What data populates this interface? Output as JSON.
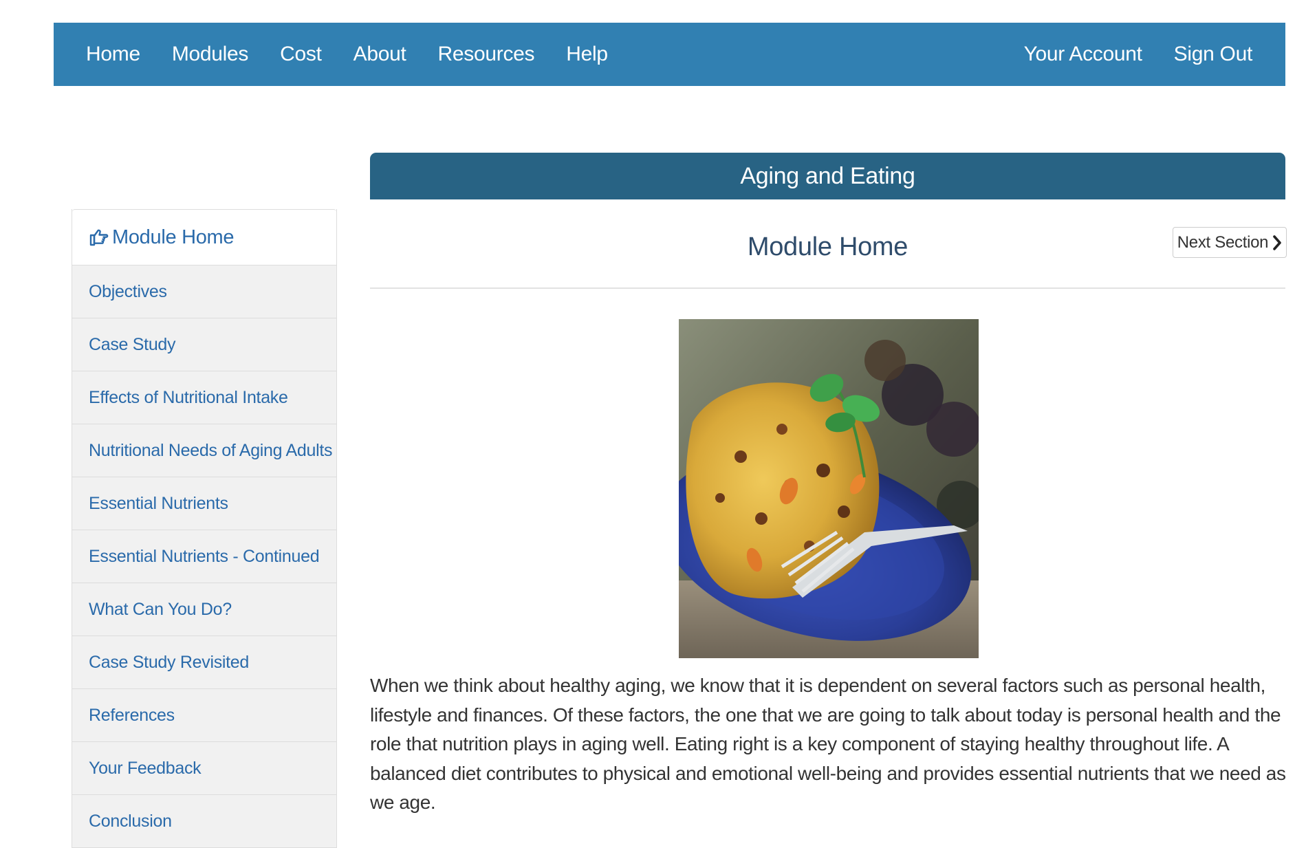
{
  "navbar": {
    "left_items": [
      "Home",
      "Modules",
      "Cost",
      "About",
      "Resources",
      "Help"
    ],
    "right_items": [
      "Your Account",
      "Sign Out"
    ],
    "background_color": "#3180b2"
  },
  "module": {
    "title": "Aging and Eating",
    "header_color": "#286384"
  },
  "sidebar": {
    "active_item": {
      "icon": "hand-pointing-right-icon",
      "label": "Module Home"
    },
    "items": [
      "Objectives",
      "Case Study",
      "Effects of Nutritional Intake",
      "Nutritional Needs of Aging Adults",
      "Essential Nutrients",
      "Essential Nutrients - Continued",
      "What Can You Do?",
      "Case Study Revisited",
      "References",
      "Your Feedback",
      "Conclusion"
    ]
  },
  "content": {
    "section_title": "Module Home",
    "next_button": {
      "label": "Next Section",
      "icon": "chevron-right-icon"
    },
    "image": {
      "subject": "food-photo-couscous-plate"
    },
    "intro_paragraph": "When we think about healthy aging, we know that it is dependent on several factors such as personal health, lifestyle and finances. Of these factors, the one that we are going to talk about today is personal health and the role that nutrition plays in aging well.  Eating right is a key component of staying healthy throughout life. A balanced diet contributes to physical and emotional well-being and provides essential nutrients that we need as we age."
  }
}
